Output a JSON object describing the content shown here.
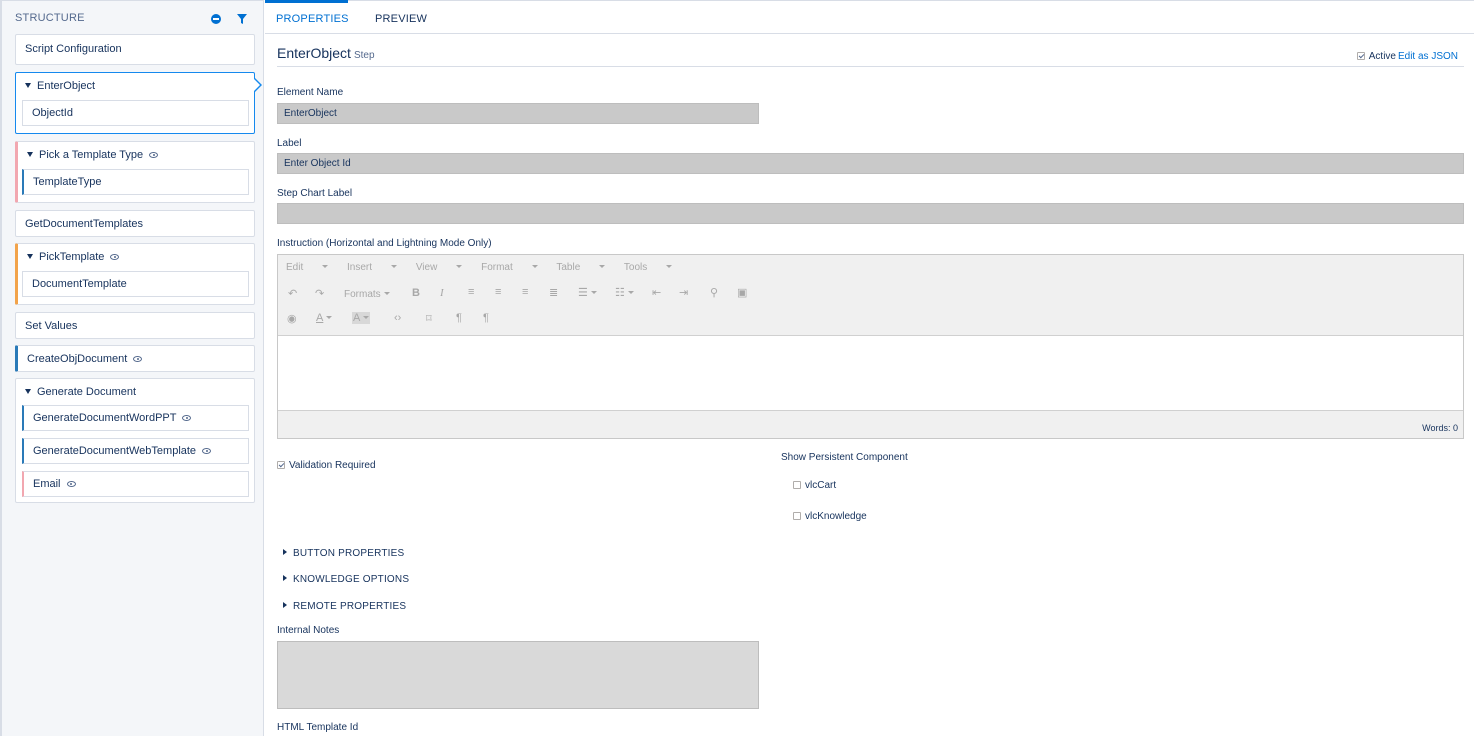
{
  "structure": {
    "heading": "STRUCTURE",
    "items": [
      {
        "label": "Script Configuration"
      },
      {
        "label": "EnterObject",
        "children": [
          "ObjectId"
        ]
      },
      {
        "label": "Pick a Template Type",
        "children": [
          "TemplateType"
        ]
      },
      {
        "label": "GetDocumentTemplates"
      },
      {
        "label": "PickTemplate",
        "children": [
          "DocumentTemplate"
        ]
      },
      {
        "label": "Set Values"
      },
      {
        "label": "CreateObjDocument"
      },
      {
        "label": "Generate Document",
        "children": [
          "GenerateDocumentWordPPT",
          "GenerateDocumentWebTemplate",
          "Email"
        ]
      }
    ]
  },
  "tabs": [
    {
      "label": "PROPERTIES",
      "active": true
    },
    {
      "label": "PREVIEW",
      "active": false
    }
  ],
  "properties": {
    "title": "EnterObject",
    "subtitle": "Step",
    "active_label": "Active",
    "active_checked": true,
    "edit_json_label": "Edit as JSON",
    "element_name_label": "Element Name",
    "element_name_value": "EnterObject",
    "label_label": "Label",
    "label_value": "Enter Object Id",
    "step_chart_label": "Step Chart Label",
    "step_chart_value": "",
    "instruction_label": "Instruction (Horizontal and Lightning Mode Only)",
    "editor_menus": [
      "Edit",
      "Insert",
      "View",
      "Format",
      "Table",
      "Tools"
    ],
    "formats_label": "Formats",
    "words_label": "Words: 0",
    "validation_label": "Validation Required",
    "validation_checked": true,
    "persistent_label": "Show Persistent Component",
    "persistent_options": [
      {
        "label": "vlcCart",
        "checked": false
      },
      {
        "label": "vlcKnowledge",
        "checked": false
      }
    ],
    "sections": [
      "BUTTON PROPERTIES",
      "KNOWLEDGE OPTIONS",
      "REMOTE PROPERTIES"
    ],
    "internal_notes_label": "Internal Notes",
    "html_template_label": "HTML Template Id"
  },
  "colors": {
    "accent": "#0070d2",
    "selected_border": "#1589ee",
    "bar_pink": "#f2a7b0",
    "bar_orange": "#f2a34a",
    "bar_blue": "#2a7ab8"
  },
  "icons": [
    "minus-circle-icon",
    "filter-icon",
    "caret-down-icon",
    "eye-icon",
    "checkbox-icon",
    "triangle-right-icon"
  ]
}
